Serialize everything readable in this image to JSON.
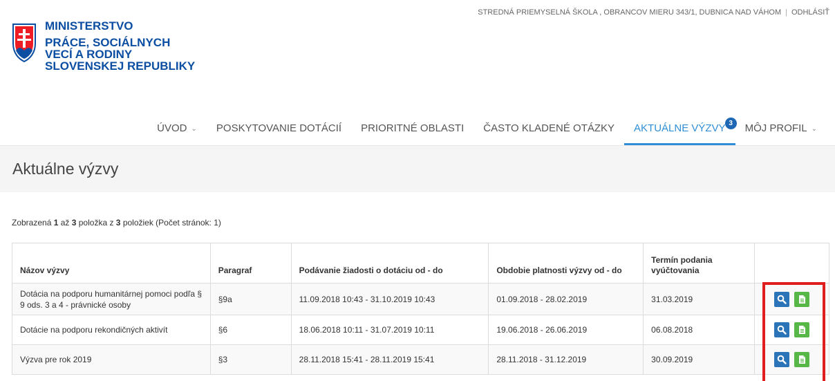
{
  "topbar": {
    "school": "STREDNÁ PRIEMYSELNÁ ŠKOLA , OBRANCOV MIERU 343/1, DUBNICA NAD VÁHOM",
    "separator": "|",
    "logout": "ODHLÁSIŤ"
  },
  "logo": {
    "line1": "MINISTERSTVO",
    "line2": "PRÁCE, SOCIÁLNYCH",
    "line3": "VECÍ A RODINY",
    "line4": "SLOVENSKEJ REPUBLIKY",
    "color": "#0b4ea2",
    "crest_colors": [
      "#ee1c25",
      "#0b4ea2",
      "#ffffff"
    ]
  },
  "nav": {
    "items": [
      {
        "label": "ÚVOD",
        "dropdown": true
      },
      {
        "label": "POSKYTOVANIE DOTÁCIÍ"
      },
      {
        "label": "PRIORITNÉ OBLASTI"
      },
      {
        "label": "ČASTO KLADENÉ OTÁZKY"
      },
      {
        "label": "AKTUÁLNE VÝZVY",
        "active": true,
        "badge": "3"
      },
      {
        "label": "MÔJ PROFIL",
        "dropdown": true
      }
    ],
    "active_color": "#2f8fd6"
  },
  "page": {
    "title": "Aktuálne výzvy"
  },
  "summary": {
    "prefix": "Zobrazená ",
    "from": "1",
    "mid1": " až ",
    "to": "3",
    "mid2": " položka z ",
    "total": "3",
    "suffix": " položiek (Počet stránok: 1)"
  },
  "table": {
    "headers": [
      "Názov výzvy",
      "Paragraf",
      "Podávanie žiadosti o dotáciu od - do",
      "Obdobie platnosti výzvy od - do",
      "Termín podania vyúčtovania",
      ""
    ],
    "rows": [
      {
        "name": "Dotácia na podporu humanitárnej pomoci podľa § 9 ods. 3 a 4 - právnické osoby",
        "paragraf": "§9a",
        "podavanie": "11.09.2018 10:43 - 31.10.2019 10:43",
        "obdobie": "01.09.2018 - 28.02.2019",
        "termin": "31.03.2019"
      },
      {
        "name": "Dotácie na podporu rekondičných aktivít",
        "paragraf": "§6",
        "podavanie": "18.06.2018 10:11 - 31.07.2019 10:11",
        "obdobie": "19.06.2018 - 26.06.2019",
        "termin": "06.08.2018"
      },
      {
        "name": "Výzva pre rok 2019",
        "paragraf": "§3",
        "podavanie": "28.11.2018 15:41 - 28.11.2019 15:41",
        "obdobie": "28.11.2018 - 31.12.2019",
        "termin": "30.09.2019"
      }
    ],
    "row_actions": [
      {
        "icon": "search-icon",
        "color": "#2b74b8"
      },
      {
        "icon": "document-icon",
        "color": "#57b847"
      }
    ]
  },
  "highlight_color": "#e01e1e"
}
